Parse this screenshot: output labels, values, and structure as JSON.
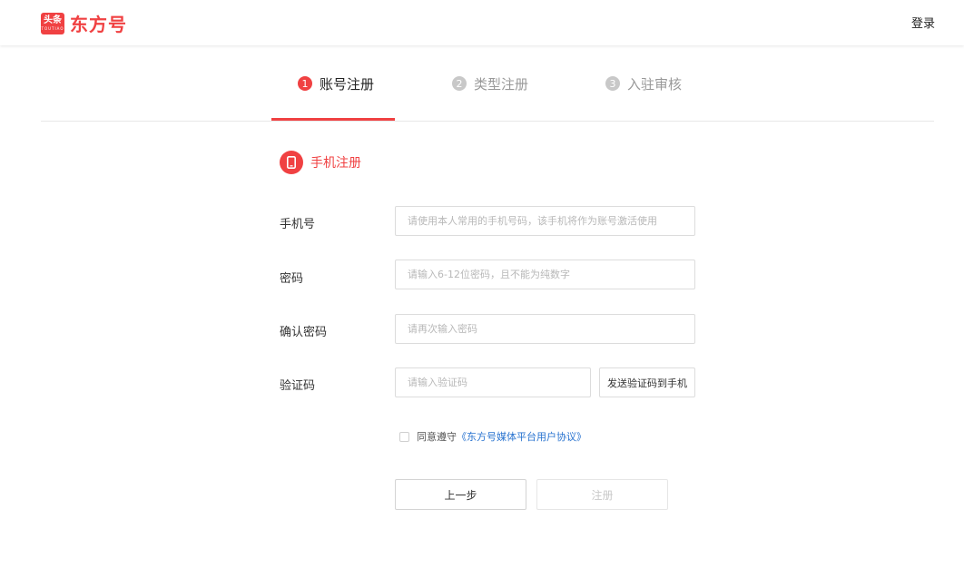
{
  "header": {
    "logo_badge": "头条",
    "logo_badge_sub": "TOUTIAO",
    "logo_text": "东方号",
    "login_label": "登录"
  },
  "steps": [
    {
      "num": "1",
      "label": "账号注册",
      "active": true
    },
    {
      "num": "2",
      "label": "类型注册",
      "active": false
    },
    {
      "num": "3",
      "label": "入驻审核",
      "active": false
    }
  ],
  "section": {
    "title": "手机注册",
    "icon": "phone-icon"
  },
  "form": {
    "phone_label": "手机号",
    "phone_placeholder": "请使用本人常用的手机号码，该手机将作为账号激活使用",
    "password_label": "密码",
    "password_placeholder": "请输入6-12位密码，且不能为纯数字",
    "confirm_label": "确认密码",
    "confirm_placeholder": "请再次输入密码",
    "code_label": "验证码",
    "code_placeholder": "请输入验证码",
    "send_code_label": "发送验证码到手机"
  },
  "agreement": {
    "prefix": "同意遵守",
    "link": "《东方号媒体平台用户协议》",
    "checked": false
  },
  "buttons": {
    "prev_label": "上一步",
    "register_label": "注册"
  },
  "colors": {
    "brand": "#f04142",
    "link": "#2a74d0"
  }
}
